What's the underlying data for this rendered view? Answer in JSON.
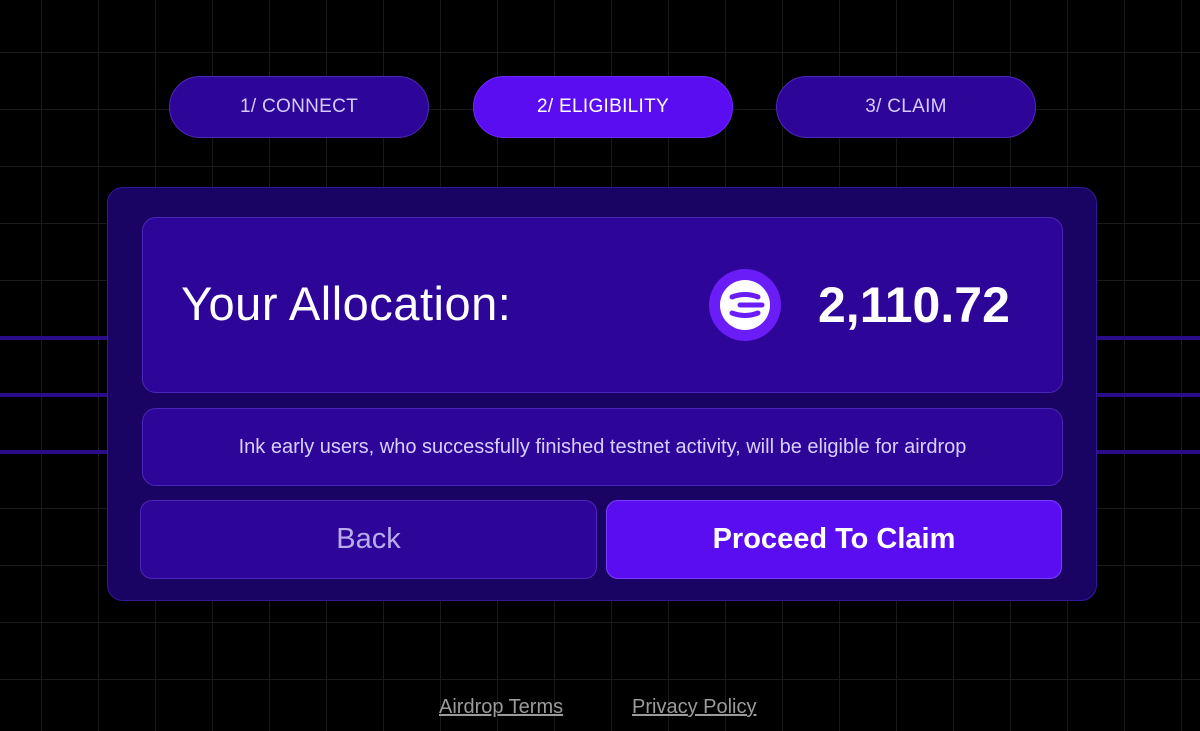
{
  "steps": [
    {
      "label": "1/ CONNECT",
      "active": false
    },
    {
      "label": "2/ ELIGIBILITY",
      "active": true
    },
    {
      "label": "3/ CLAIM",
      "active": false
    }
  ],
  "allocation": {
    "label": "Your Allocation:",
    "amount": "2,110.72",
    "token_icon": "ink-token-icon"
  },
  "notice": "Ink early users, who successfully finished testnet activity, will be eligible for airdrop",
  "buttons": {
    "back": "Back",
    "proceed": "Proceed To Claim"
  },
  "footer": {
    "terms": "Airdrop Terms",
    "privacy": "Privacy Policy"
  },
  "colors": {
    "background": "#000000",
    "card": "#1a0463",
    "panel": "#2e0599",
    "accent": "#5b0df2"
  }
}
